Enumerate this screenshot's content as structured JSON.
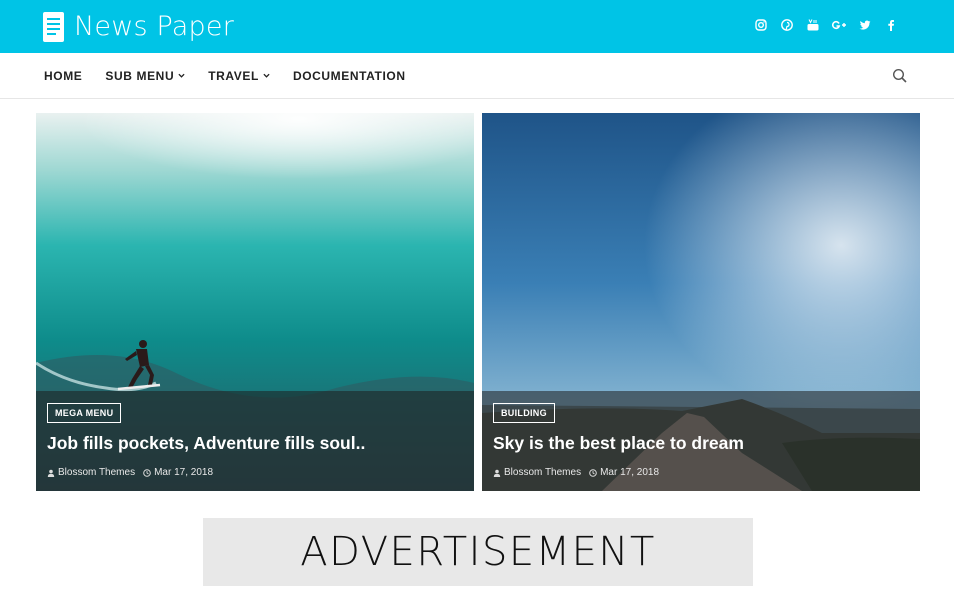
{
  "brand": {
    "name": "News Paper",
    "bar_color": "#00c4e6"
  },
  "social_icons": [
    "instagram-icon",
    "pinterest-icon",
    "youtube-icon",
    "google-plus-icon",
    "twitter-icon",
    "facebook-icon"
  ],
  "nav": {
    "items": [
      {
        "label": "HOME",
        "has_dropdown": false
      },
      {
        "label": "SUB MENU",
        "has_dropdown": true
      },
      {
        "label": "TRAVEL",
        "has_dropdown": true
      },
      {
        "label": "DOCUMENTATION",
        "has_dropdown": false
      }
    ],
    "search_icon": "search-icon"
  },
  "featured": [
    {
      "category": "MEGA MENU",
      "title": "Job fills pockets, Adventure fills soul..",
      "author": "Blossom Themes",
      "date": "Mar 17, 2018"
    },
    {
      "category": "BUILDING",
      "title": "Sky is the best place to dream",
      "author": "Blossom Themes",
      "date": "Mar 17, 2018"
    }
  ],
  "advertisement": {
    "label": "ADVERTISEMENT"
  }
}
